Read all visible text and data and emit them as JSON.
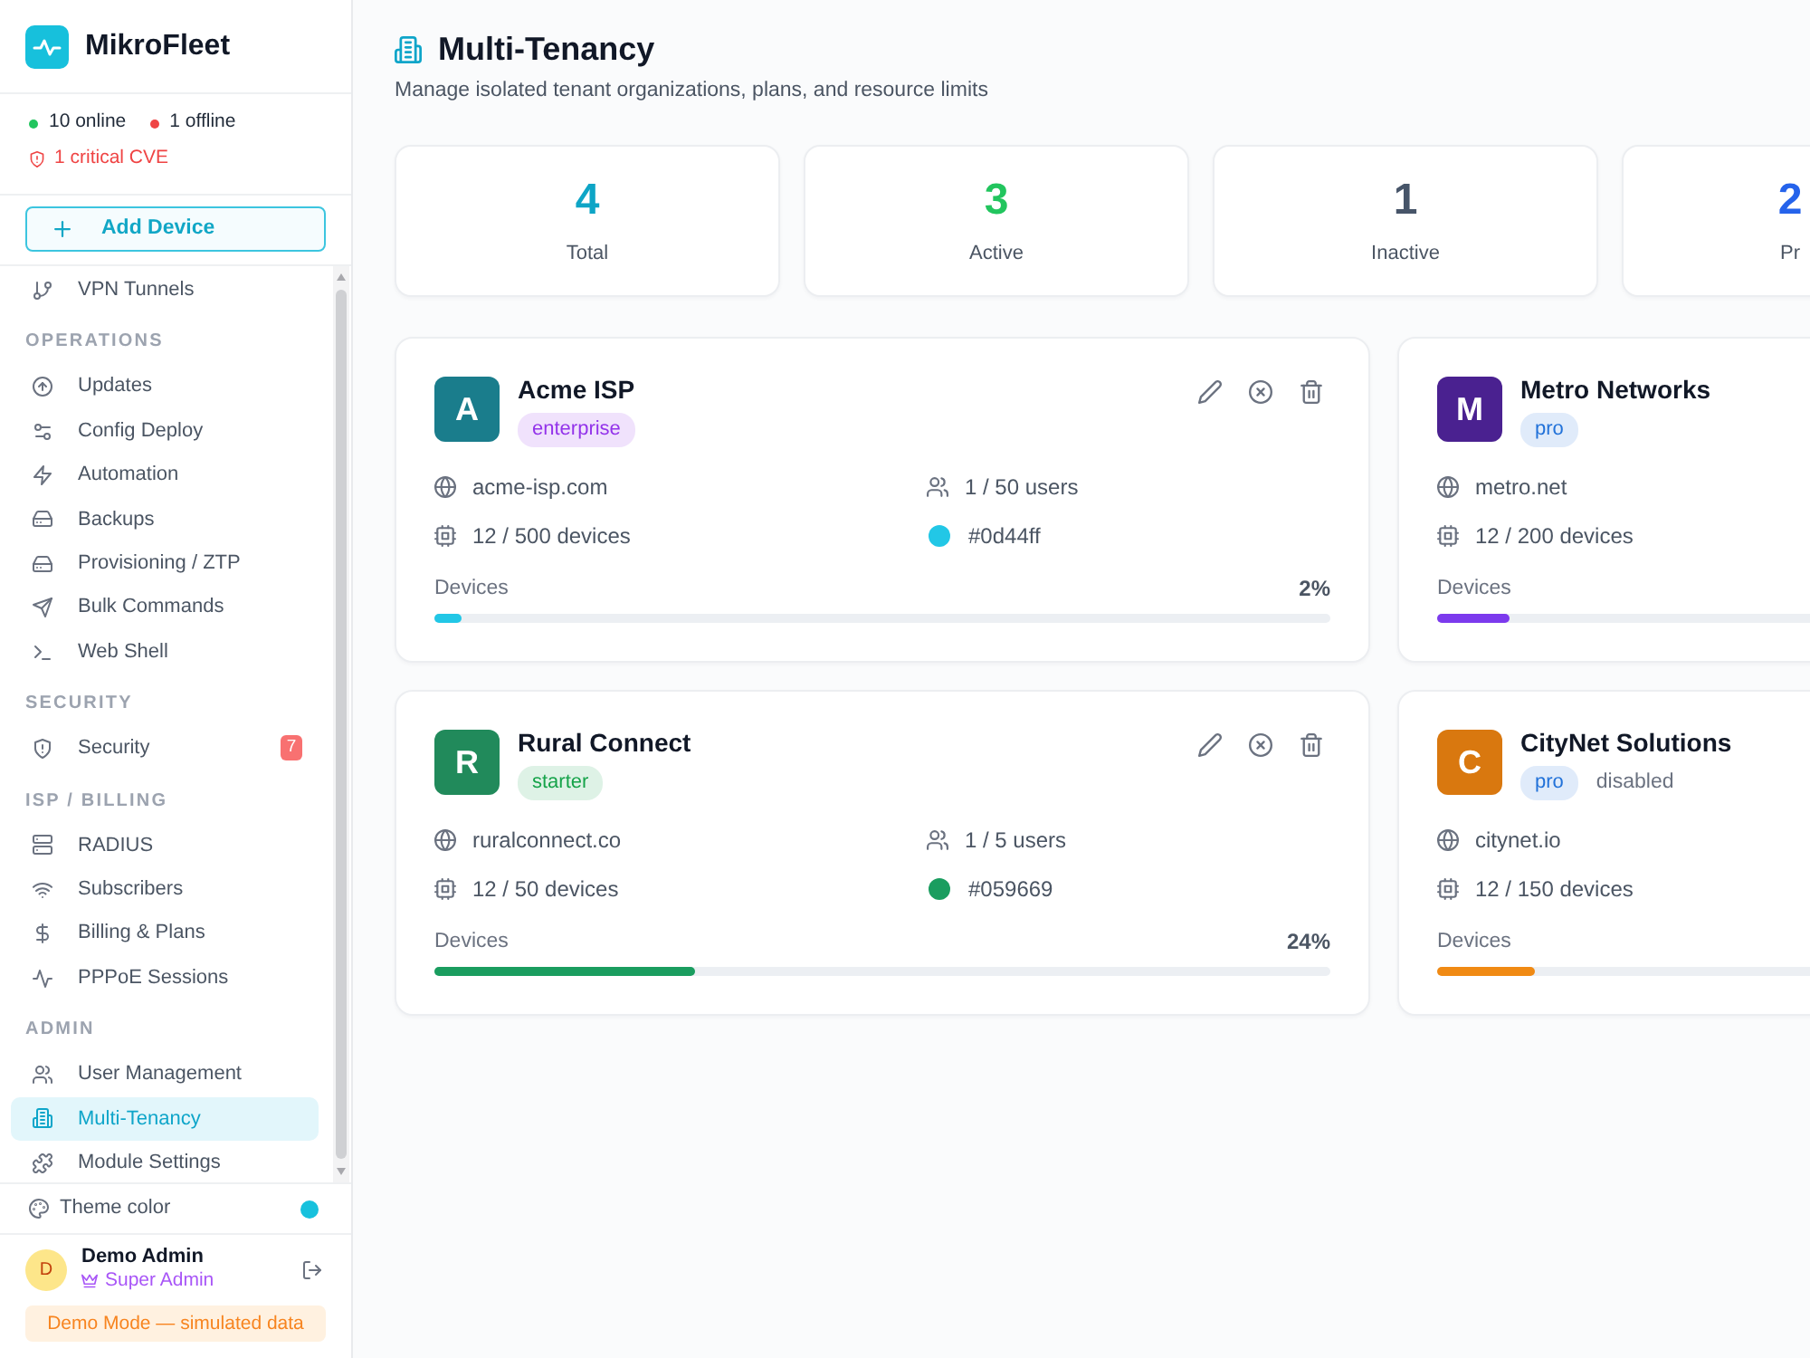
{
  "sidebar": {
    "brand": "MikroFleet",
    "counts": [
      {
        "text": "10 online",
        "color": "#22c55e"
      },
      {
        "text": "1 offline",
        "color": "#ef4444"
      }
    ],
    "alert": "1 critical CVE",
    "add_button": "Add Device",
    "sections": [
      {
        "items": [
          {
            "label": "VPN Tunnels",
            "selected": false
          }
        ]
      },
      {
        "title": "OPERATIONS",
        "items": [
          {
            "label": "Updates",
            "selected": false
          },
          {
            "label": "Config Deploy",
            "selected": false
          },
          {
            "label": "Automation",
            "selected": false
          },
          {
            "label": "Backups",
            "selected": false
          },
          {
            "label": "Provisioning / ZTP",
            "selected": false
          },
          {
            "label": "Bulk Commands",
            "selected": false
          },
          {
            "label": "Web Shell",
            "selected": false
          }
        ]
      },
      {
        "title": "SECURITY",
        "items": [
          {
            "label": "Security",
            "selected": false,
            "badge": "7"
          }
        ]
      },
      {
        "title": "ISP / BILLING",
        "items": [
          {
            "label": "RADIUS",
            "selected": false
          },
          {
            "label": "Subscribers",
            "selected": false
          },
          {
            "label": "Billing & Plans",
            "selected": false
          },
          {
            "label": "PPPoE Sessions",
            "selected": false
          }
        ]
      },
      {
        "title": "ADMIN",
        "items": [
          {
            "label": "User Management",
            "selected": false
          },
          {
            "label": "Multi-Tenancy",
            "selected": true
          },
          {
            "label": "Module Settings",
            "selected": false
          }
        ]
      }
    ],
    "theme": {
      "label": "Theme color",
      "color": "#17c1dd"
    },
    "user": {
      "initial": "D",
      "name": "Demo Admin",
      "role": "Super Admin"
    },
    "demo_notice": "Demo Mode — simulated data"
  },
  "page": {
    "title": "Multi-Tenancy",
    "subtitle": "Manage isolated tenant organizations, plans, and resource limits"
  },
  "stats": [
    {
      "value": "4",
      "label": "Total",
      "color": "#0ea5c6"
    },
    {
      "value": "3",
      "label": "Active",
      "color": "#22c55e"
    },
    {
      "value": "1",
      "label": "Inactive",
      "color": "#475569"
    },
    {
      "value": "2",
      "label": "Pr",
      "color": "#2563eb"
    }
  ],
  "tenants": [
    {
      "avatar": {
        "initial": "A",
        "color": "#1a7d8c"
      },
      "name": "Acme ISP",
      "plan": {
        "text": "enterprise",
        "color": "#9333ea"
      },
      "actions": true,
      "domain": "acme-isp.com",
      "devices": "12 / 500 devices",
      "users": "1 / 50 users",
      "swatch": {
        "text": "#0d44ff",
        "color": "#22c7e6"
      },
      "progress": {
        "label": "Devices",
        "reading": "2%",
        "level": 0.03,
        "color": "#22c7e6"
      }
    },
    {
      "avatar": {
        "initial": "M",
        "color": "#4a2190"
      },
      "name": "Metro Networks",
      "plan": {
        "text": "pro",
        "color": "#2272d9"
      },
      "actions": false,
      "domain": "metro.net",
      "devices": "12 / 200 devices",
      "progress": {
        "label": "Devices",
        "level": 0.08,
        "color": "#7c3aed"
      }
    },
    {
      "avatar": {
        "initial": "R",
        "color": "#218a5b"
      },
      "name": "Rural Connect",
      "plan": {
        "text": "starter",
        "color": "#16a34a"
      },
      "actions": true,
      "domain": "ruralconnect.co",
      "devices": "12 / 50 devices",
      "users": "1 / 5 users",
      "swatch": {
        "text": "#059669",
        "color": "#1a9d5f"
      },
      "progress": {
        "label": "Devices",
        "reading": "24%",
        "level": 0.29,
        "color": "#1a9d5f"
      }
    },
    {
      "avatar": {
        "initial": "C",
        "color": "#d9780f"
      },
      "name": "CityNet Solutions",
      "plan": {
        "text": "pro",
        "color": "#2272d9"
      },
      "actions": false,
      "status": "disabled",
      "domain": "citynet.io",
      "devices": "12 / 150 devices",
      "progress": {
        "label": "Devices",
        "level": 0.11,
        "color": "#f08a14"
      }
    }
  ]
}
